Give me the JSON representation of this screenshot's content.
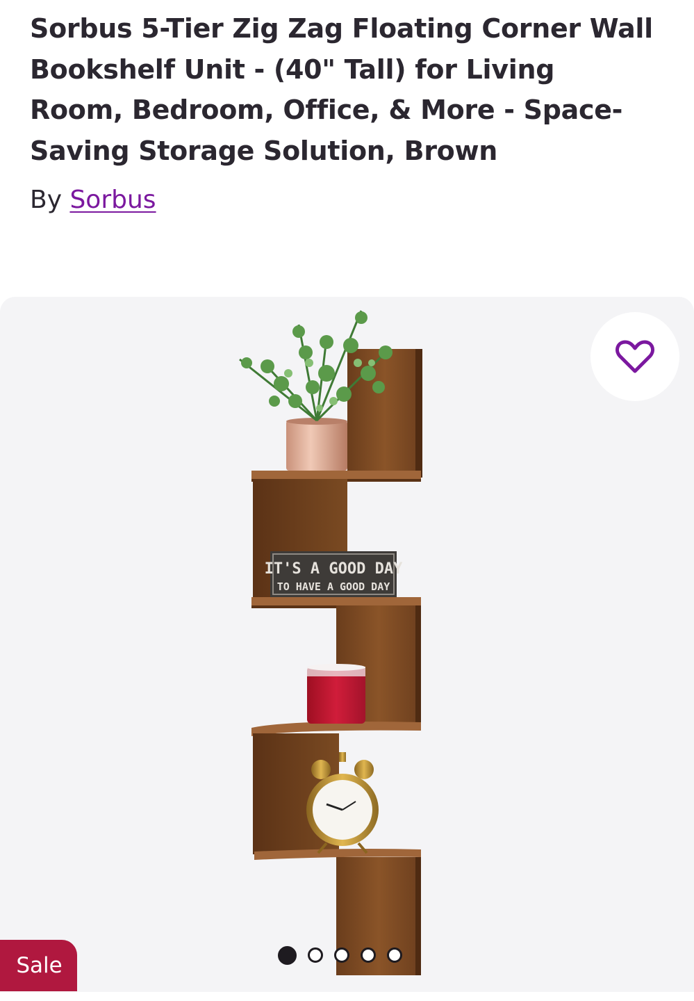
{
  "product": {
    "title": "Sorbus 5-Tier Zig Zag Floating Corner Wall Bookshelf Unit - (40\" Tall) for Living Room, Bedroom, Office, & More - Space-Saving Storage Solution, Brown",
    "by_prefix": "By ",
    "brand": "Sorbus"
  },
  "gallery": {
    "sign_line1": "IT'S A GOOD DAY",
    "sign_line2": "TO HAVE A GOOD DAY",
    "favorite_icon": "heart-outline-icon",
    "dot_count": 5,
    "active_dot": 0,
    "sale_label": "Sale"
  },
  "colors": {
    "brand_link": "#7b189f",
    "favorite_icon": "#7b189f",
    "sale_badge": "#b0183f",
    "gallery_bg": "#f4f4f6",
    "title_text": "#2b2730"
  }
}
